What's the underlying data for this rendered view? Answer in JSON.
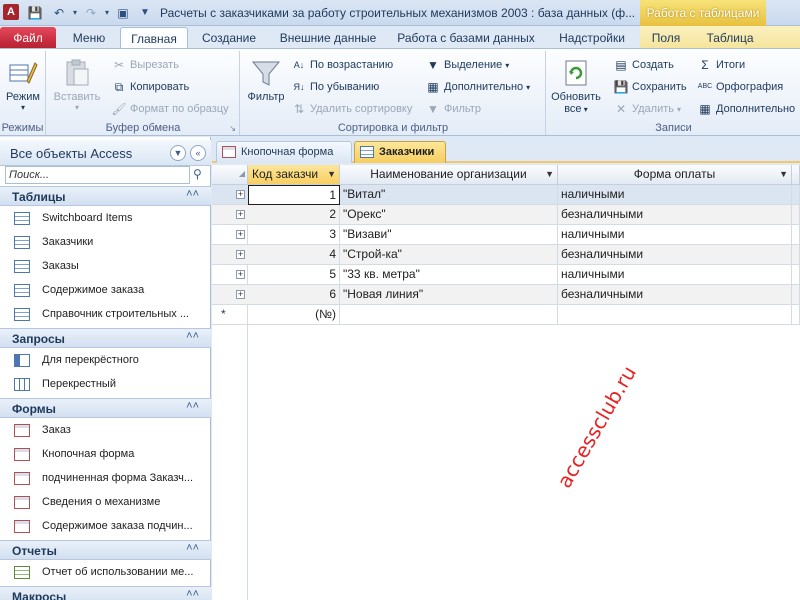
{
  "window": {
    "title": "Расчеты с заказчиками за работу строительных механизмов 2003 : база данных (ф...",
    "context_tab_title": "Работа с таблицами",
    "app_icon": "A"
  },
  "ribbon_tabs": [
    {
      "label": "Файл"
    },
    {
      "label": "Меню"
    },
    {
      "label": "Главная"
    },
    {
      "label": "Создание"
    },
    {
      "label": "Внешние данные"
    },
    {
      "label": "Работа с базами данных"
    },
    {
      "label": "Надстройки"
    },
    {
      "label": "Поля"
    },
    {
      "label": "Таблица"
    }
  ],
  "ribbon": {
    "views": {
      "label": "Режимы",
      "mode_btn": "Режим"
    },
    "clipboard": {
      "label": "Буфер обмена",
      "paste": "Вставить",
      "cut": "Вырезать",
      "copy": "Копировать",
      "format_painter": "Формат по образцу"
    },
    "sort_filter": {
      "label": "Сортировка и фильтр",
      "filter": "Фильтр",
      "ascending": "По возрастанию",
      "descending": "По убыванию",
      "remove_sort": "Удалить сортировку",
      "selection": "Выделение",
      "advanced": "Дополнительно",
      "toggle_filter": "Фильтр"
    },
    "records": {
      "label": "Записи",
      "refresh": "Обновить",
      "refresh2": "все",
      "new": "Создать",
      "save": "Сохранить",
      "delete": "Удалить",
      "totals": "Итоги",
      "spelling": "Орфография",
      "more": "Дополнительно"
    }
  },
  "nav": {
    "title": "Все объекты Access",
    "search_placeholder": "Поиск...",
    "sections": [
      {
        "label": "Таблицы",
        "items": [
          "Switchboard Items",
          "Заказчики",
          "Заказы",
          "Содержимое заказа",
          "Справочник строительных ..."
        ]
      },
      {
        "label": "Запросы",
        "items": [
          "Для перекрёстного",
          "Перекрестный"
        ]
      },
      {
        "label": "Формы",
        "items": [
          "Заказ",
          "Кнопочная форма",
          "подчиненная форма Заказч...",
          "Сведения о механизме",
          "Содержимое заказа подчин..."
        ]
      },
      {
        "label": "Отчеты",
        "items": [
          "Отчет об использовании ме..."
        ]
      },
      {
        "label": "Макросы",
        "items": []
      }
    ]
  },
  "doc_tabs": [
    {
      "label": "Кнопочная форма"
    },
    {
      "label": "Заказчики"
    }
  ],
  "datasheet": {
    "columns": [
      "Код заказчи",
      "Наименование организации",
      "Форма оплаты"
    ],
    "rows": [
      {
        "id": "1",
        "name": "\"Витал\"",
        "payment": "наличными"
      },
      {
        "id": "2",
        "name": "\"Орекс\"",
        "payment": "безналичными"
      },
      {
        "id": "3",
        "name": "\"Визави\"",
        "payment": "наличными"
      },
      {
        "id": "4",
        "name": "\"Строй-ка\"",
        "payment": "безналичными"
      },
      {
        "id": "5",
        "name": "\"33 кв. метра\"",
        "payment": "наличными"
      },
      {
        "id": "6",
        "name": "\"Новая линия\"",
        "payment": "безналичными"
      }
    ],
    "new_row_label": "(№)",
    "new_row_marker": "*"
  },
  "watermark": "accessclub.ru",
  "colors": {
    "file_tab": "#c8293a",
    "accent_yellow": "#f8cf62",
    "ribbon_blue": "#dfe9f5"
  }
}
